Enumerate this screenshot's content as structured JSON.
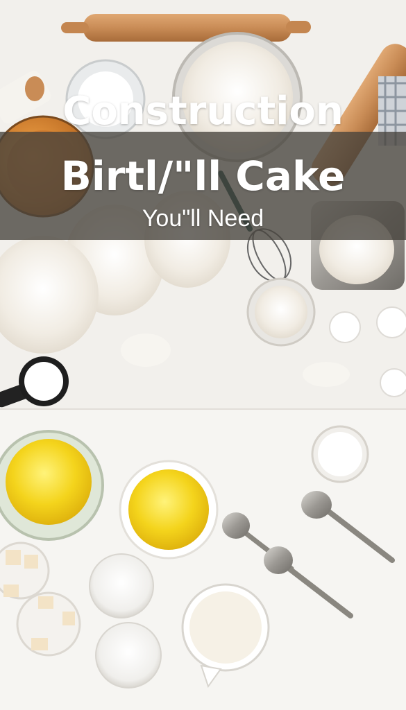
{
  "title": {
    "line1": "Construction",
    "line2": "Birtl/\"ll Cake",
    "line3": "You\"ll  Need"
  },
  "colors": {
    "background": "#f4f2ee",
    "banner": "#46423c",
    "yolk": "#f3d21c",
    "wood": "#c98c56",
    "flour": "#f6f3ec"
  }
}
